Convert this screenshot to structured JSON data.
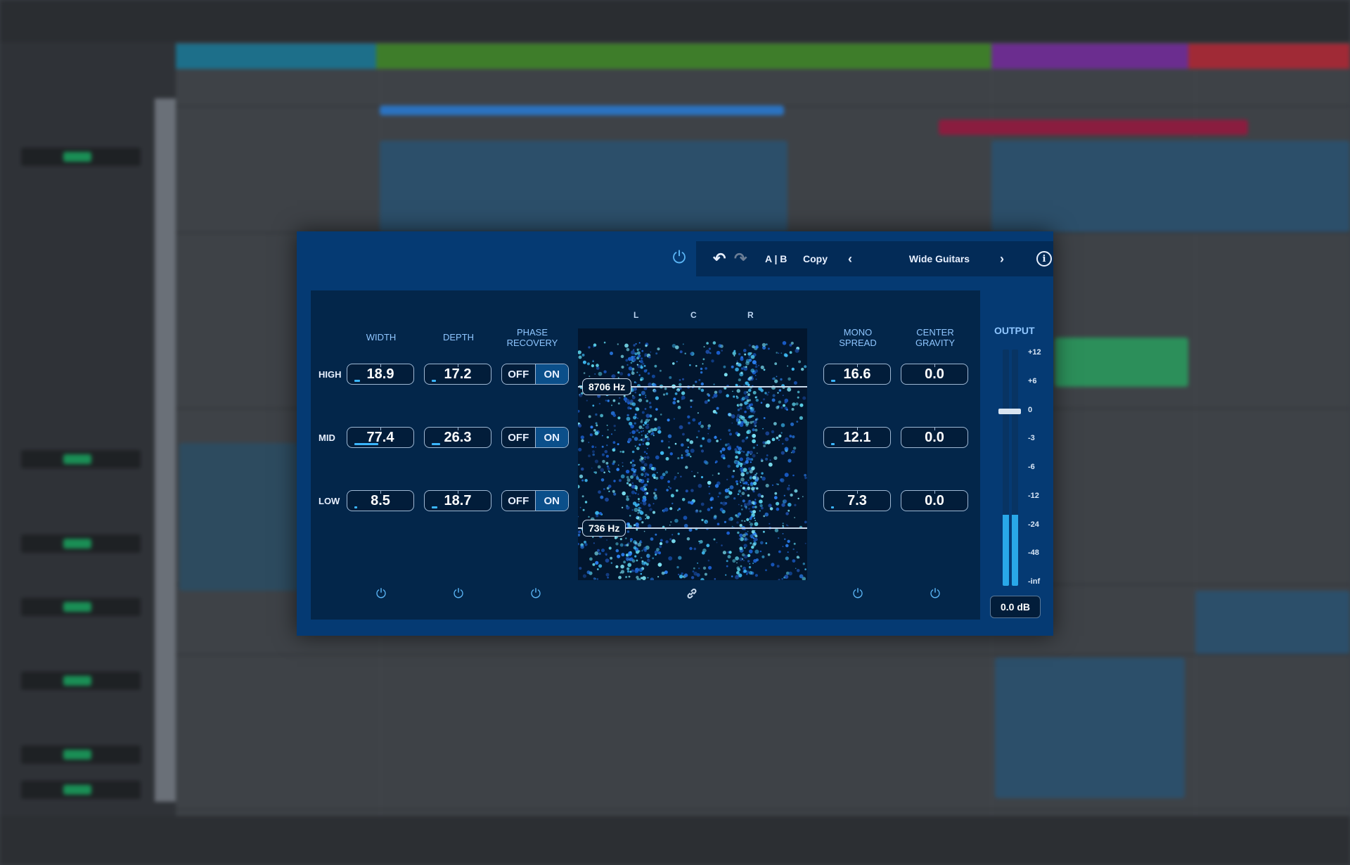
{
  "toolbar": {
    "ab_label": "A | B",
    "copy_label": "Copy",
    "preset_name": "Wide Guitars",
    "prev_glyph": "‹",
    "next_glyph": "›",
    "info_glyph": "i"
  },
  "columns": {
    "width": "WIDTH",
    "depth": "DEPTH",
    "phase_recovery": "PHASE RECOVERY",
    "mono_spread": "MONO SPREAD",
    "center_gravity": "CENTER GRAVITY"
  },
  "bands": [
    {
      "label": "HIGH",
      "width": "18.9",
      "width_level": 0.1,
      "depth": "17.2",
      "depth_level": 0.08,
      "phase_off": "OFF",
      "phase_on": "ON",
      "phase_state": "ON",
      "mono_spread": "16.6",
      "mono_level": 0.08,
      "center_gravity": "0.0"
    },
    {
      "label": "MID",
      "width": "77.4",
      "width_level": 0.45,
      "depth": "26.3",
      "depth_level": 0.16,
      "phase_off": "OFF",
      "phase_on": "ON",
      "phase_state": "ON",
      "mono_spread": "12.1",
      "mono_level": 0.06,
      "center_gravity": "0.0"
    },
    {
      "label": "LOW",
      "width": "8.5",
      "width_level": 0.04,
      "depth": "18.7",
      "depth_level": 0.1,
      "phase_off": "OFF",
      "phase_on": "ON",
      "phase_state": "ON",
      "mono_spread": "7.3",
      "mono_level": 0.0,
      "center_gravity": "0.0"
    }
  ],
  "scope": {
    "left": "L",
    "center": "C",
    "right": "R",
    "crossover_high": "8706 Hz",
    "crossover_low": "736 Hz"
  },
  "output": {
    "title": "OUTPUT",
    "readout": "0.0 dB",
    "scale": [
      "+12",
      "+6",
      "0",
      "-3",
      "-6",
      "-12",
      "-24",
      "-48",
      "-inf"
    ],
    "fader_level_db": "0",
    "meter_left_level": 0.3,
    "meter_right_level": 0.3
  },
  "colors": {
    "panel": "#053a73",
    "accent": "#5ab4f4",
    "meter": "#29a8e8"
  },
  "icons": {
    "power": "⏻",
    "undo": "↶",
    "redo": "↷",
    "link": "🔗"
  }
}
